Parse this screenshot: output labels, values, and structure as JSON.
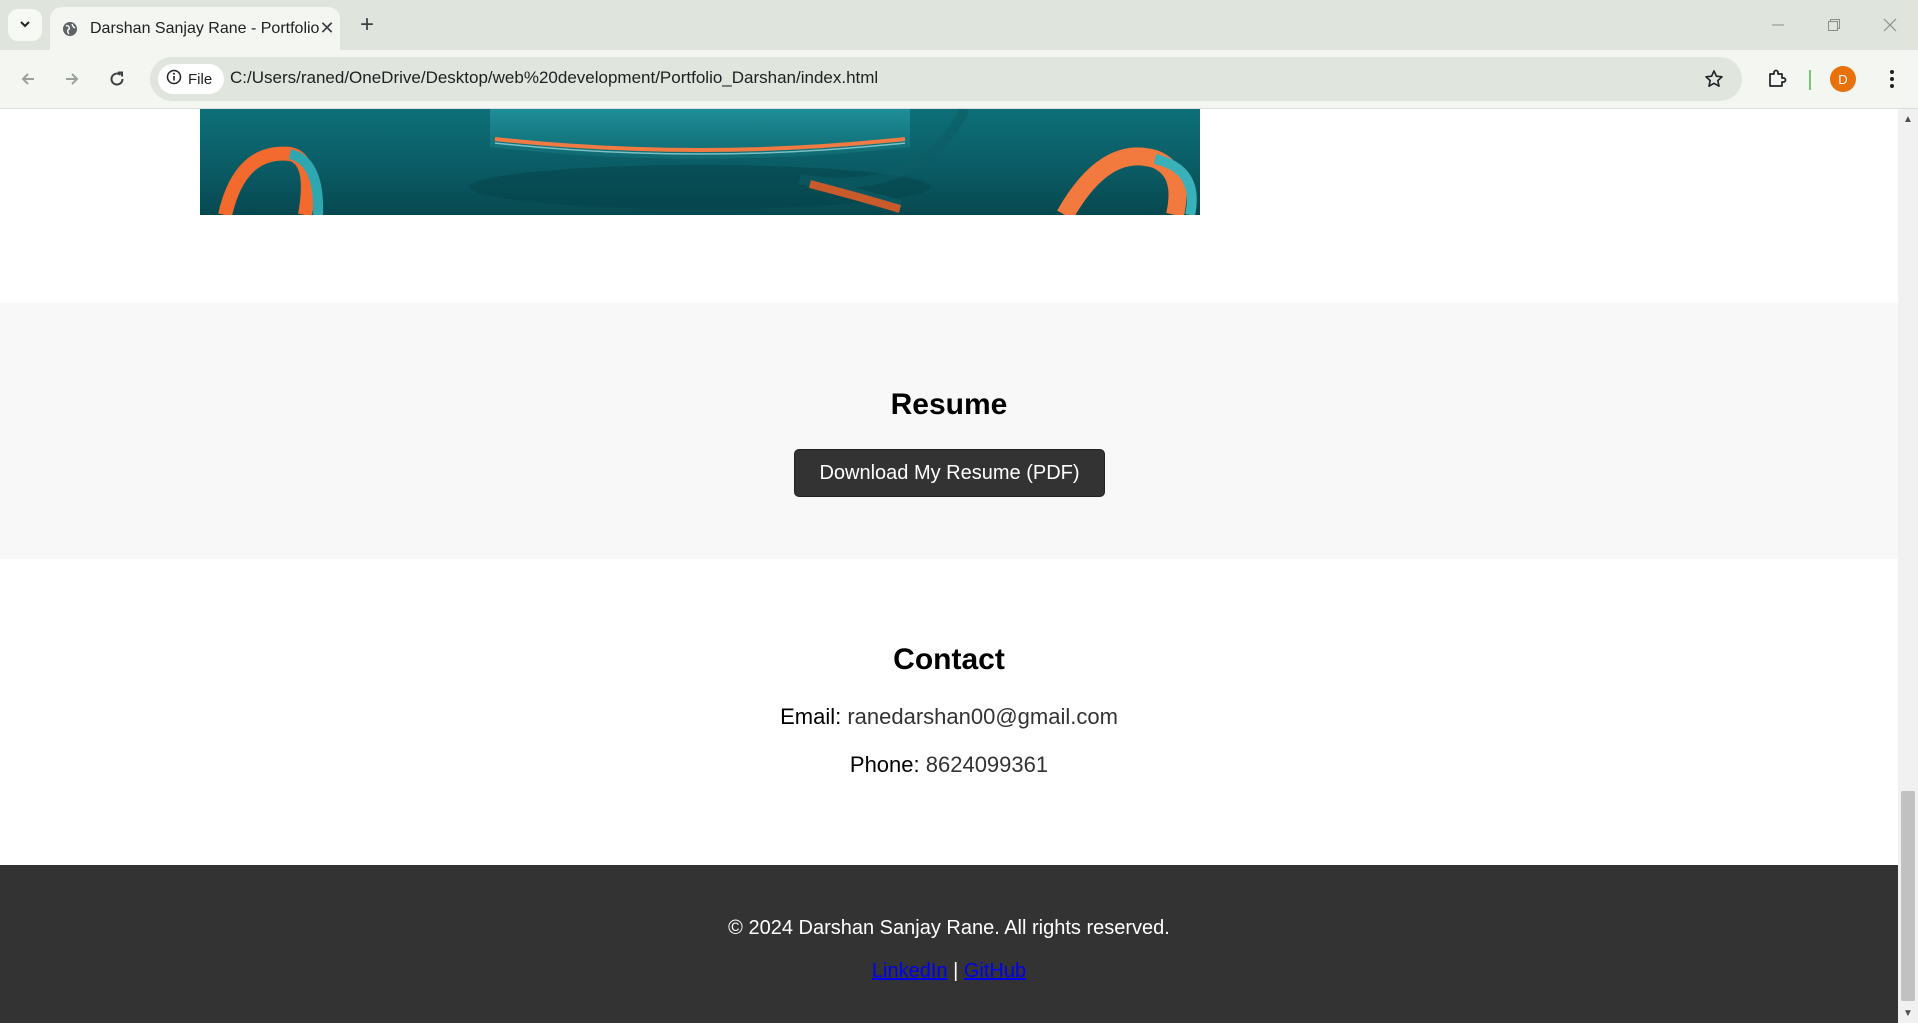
{
  "browser": {
    "tab": {
      "title": "Darshan Sanjay Rane - Portfolio"
    },
    "address": {
      "chip_label": "File",
      "url": "C:/Users/raned/OneDrive/Desktop/web%20development/Portfolio_Darshan/index.html"
    },
    "profile_initial": "D"
  },
  "page": {
    "resume": {
      "title": "Resume",
      "button_label": "Download My Resume (PDF)"
    },
    "contact": {
      "title": "Contact",
      "email_label": "Email:",
      "email_value": "ranedarshan00@gmail.com",
      "phone_label": "Phone:",
      "phone_value": "8624099361"
    },
    "footer": {
      "copyright": "© 2024 Darshan Sanjay Rane. All rights reserved.",
      "linkedin_label": "LinkedIn",
      "separator": "|",
      "github_label": "GitHub"
    }
  },
  "colors": {
    "chrome_bg": "#dfe5dc",
    "footer_bg": "#333333",
    "button_bg": "#333333",
    "section_alt_bg": "#f8f8f8",
    "link": "#0000ee",
    "avatar": "#e8710a"
  }
}
